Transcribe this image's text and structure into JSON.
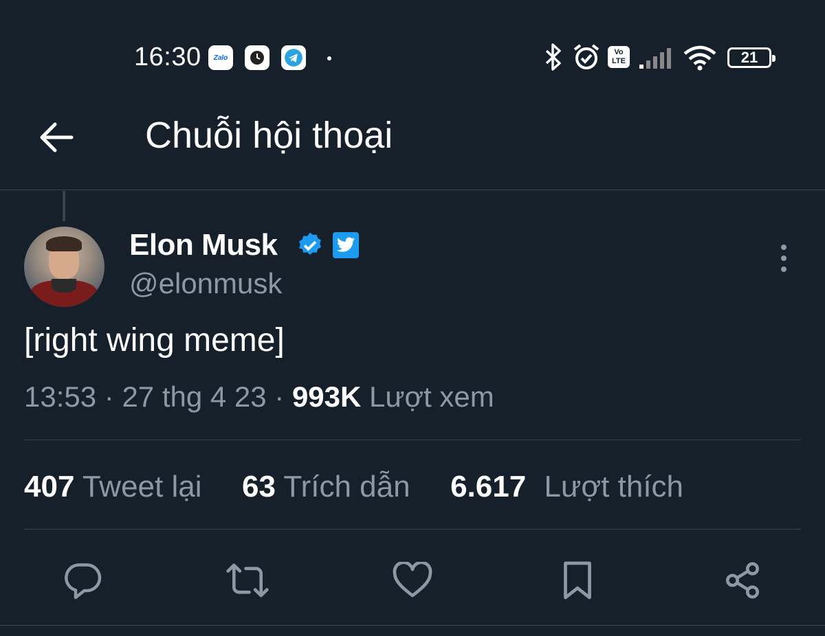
{
  "status_bar": {
    "time": "16:30",
    "zalo_label": "Zalo",
    "volte_label_top": "Vo",
    "volte_label_bottom": "LTE",
    "battery_level": "21",
    "icons": [
      "zalo-icon",
      "clock-app-icon",
      "telegram-icon",
      "bluetooth-icon",
      "alarm-icon",
      "volte-icon",
      "signal-icon",
      "wifi-icon",
      "battery-icon"
    ]
  },
  "header": {
    "title": "Chuỗi hội thoại"
  },
  "tweet": {
    "author_name": "Elon Musk",
    "author_handle": "@elonmusk",
    "text": "[right wing meme]",
    "time": "13:53",
    "date": "27 thg 4 23",
    "views_count": "993K",
    "views_label": "Lượt xem"
  },
  "stats": {
    "retweets_count": "407",
    "retweets_label": "Tweet lại",
    "quotes_count": "63",
    "quotes_label": "Trích dẫn",
    "likes_count": "6.617",
    "likes_label": "Lượt thích"
  },
  "colors": {
    "background": "#15202b",
    "secondary_text": "#8b98a5",
    "accent": "#1d9bf0",
    "divider": "#38444d"
  }
}
